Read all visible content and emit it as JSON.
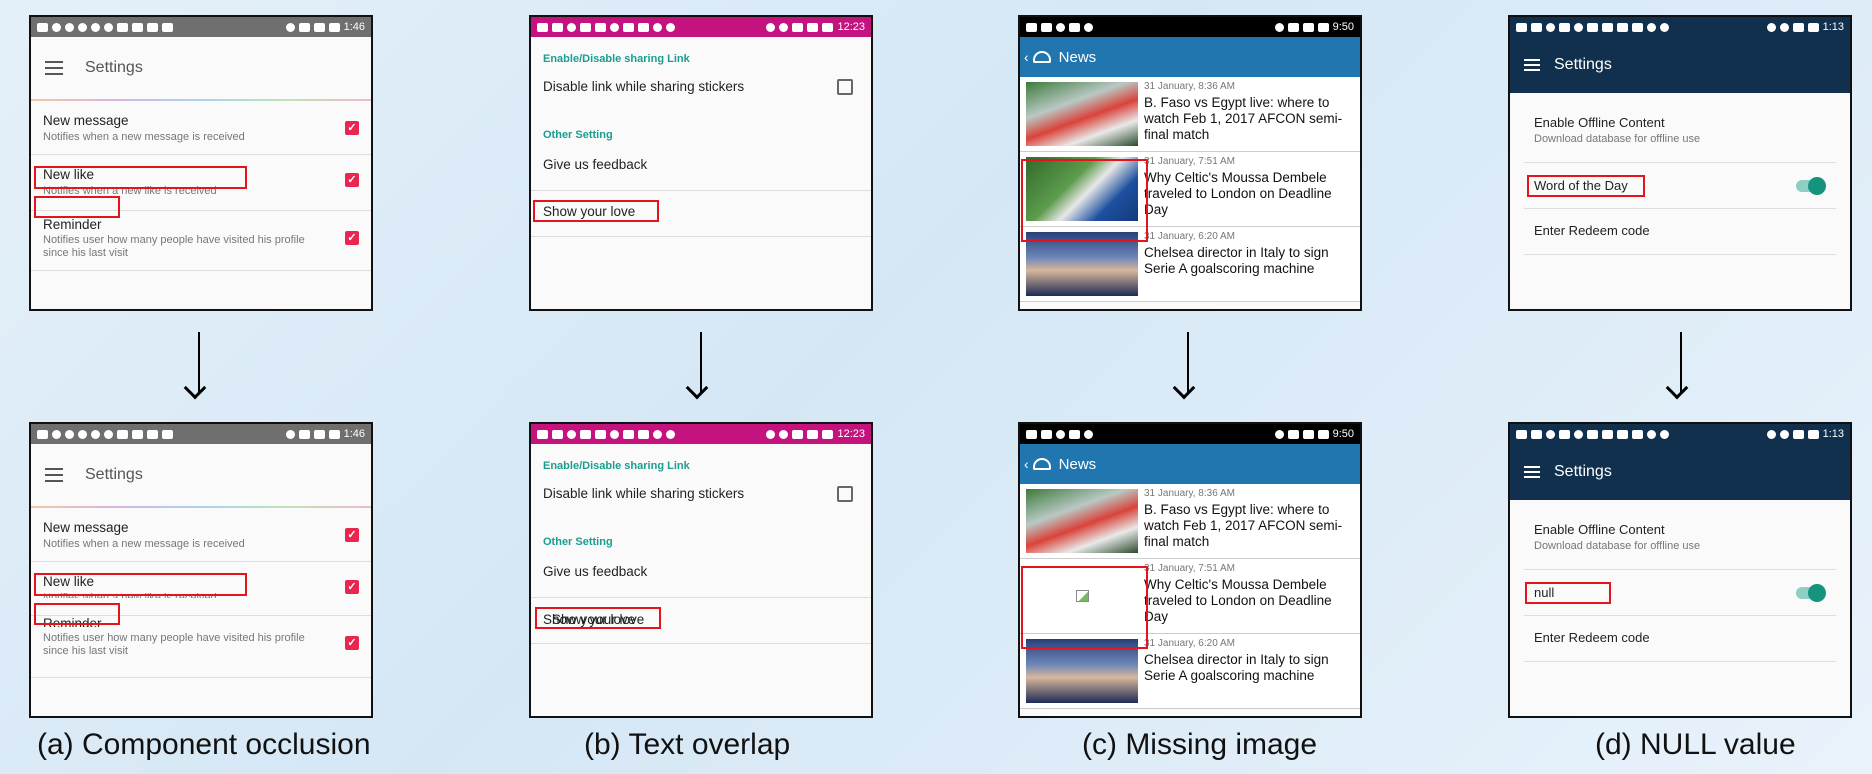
{
  "colors": {
    "settings_accent": "#e8264f",
    "teal": "#1a9e8f",
    "news_blue": "#2176b0",
    "dark_navy": "#10304d",
    "magenta": "#c4137e",
    "highlight": "#e3141b"
  },
  "a": {
    "time": "1:46",
    "title": "Settings",
    "items": [
      {
        "title": "New message",
        "sub": "Notifies when a new message is received"
      },
      {
        "title": "New like",
        "sub": "Notifies when a new like is received"
      },
      {
        "title": "Reminder",
        "sub": "Notifies user how many people have visited his profile since his last visit"
      }
    ],
    "caption": "(a) Component occlusion"
  },
  "b": {
    "time": "12:23",
    "cat1": "Enable/Disable sharing Link",
    "opt1": "Disable link while sharing stickers",
    "cat2": "Other Setting",
    "opt2": "Give us feedback",
    "opt3": "Show your love",
    "overlap": "Show your love",
    "caption": "(b) Text overlap"
  },
  "c": {
    "time": "9:50",
    "title": "News",
    "items": [
      {
        "date": "31 January, 8:36 AM",
        "headline": "B. Faso vs Egypt live: where to watch Feb 1, 2017 AFCON semi-final match"
      },
      {
        "date": "31 January, 7:51 AM",
        "headline": "Why Celtic's Moussa Dembele traveled to London on Deadline Day"
      },
      {
        "date": "31 January, 6:20 AM",
        "headline": "Chelsea director in Italy to sign Serie A goalscoring machine"
      }
    ],
    "caption": "(c) Missing image"
  },
  "d": {
    "time": "1:13",
    "title": "Settings",
    "offline_title": "Enable Offline Content",
    "offline_sub": "Download database for offline use",
    "wotd": "Word of the Day",
    "null_value": "null",
    "redeem": "Enter Redeem code",
    "caption": "(d) NULL value"
  }
}
